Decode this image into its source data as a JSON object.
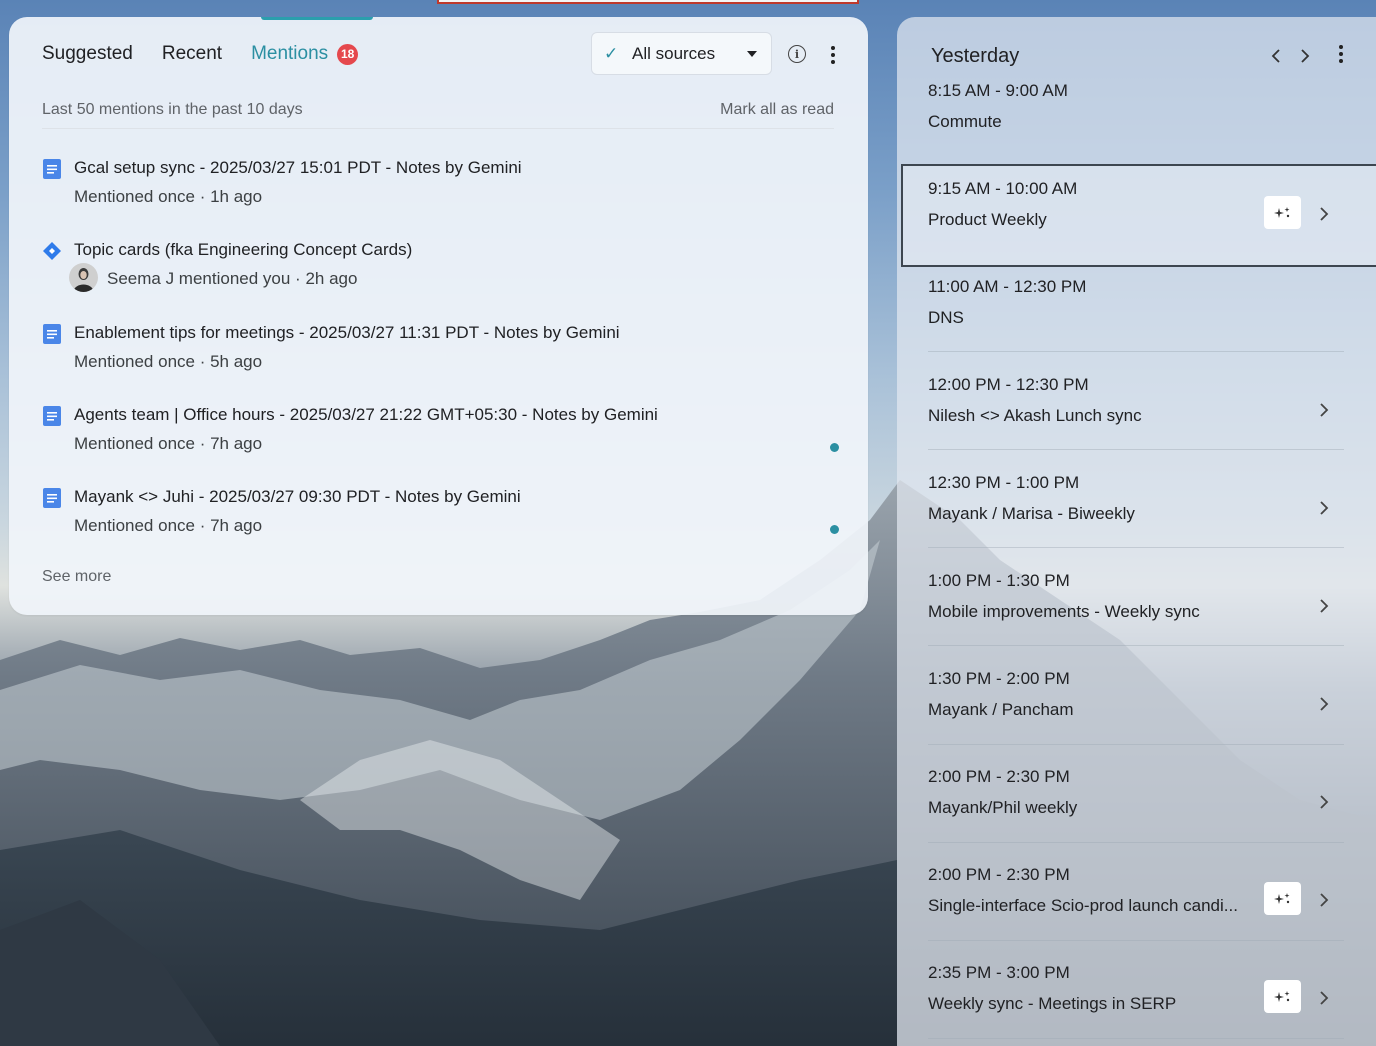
{
  "mentions_panel": {
    "tabs": [
      {
        "label": "Suggested"
      },
      {
        "label": "Recent"
      },
      {
        "label": "Mentions",
        "badge": "18"
      }
    ],
    "source_filter": {
      "selected": "All sources"
    },
    "summary": "Last 50 mentions in the past 10 days",
    "mark_all_read": "Mark all as read",
    "items": [
      {
        "title": "Gcal setup sync - 2025/03/27 15:01 PDT - Notes by Gemini",
        "meta": "Mentioned once · 1h ago",
        "icon": "doc-icon",
        "unread": false
      },
      {
        "title": "Topic cards (fka Engineering Concept Cards)",
        "meta": "Seema J mentioned you · 2h ago",
        "icon": "diamond-icon",
        "unread": false
      },
      {
        "title": "Enablement tips for meetings - 2025/03/27 11:31 PDT - Notes by Gemini",
        "meta": "Mentioned once · 5h ago",
        "icon": "doc-icon",
        "unread": false
      },
      {
        "title": "Agents team | Office hours - 2025/03/27 21:22 GMT+05:30 - Notes by Gemini",
        "meta": "Mentioned once · 7h ago",
        "icon": "doc-icon",
        "unread": true
      },
      {
        "title": "Mayank <> Juhi - 2025/03/27 09:30 PDT - Notes by Gemini",
        "meta": "Mentioned once · 7h ago",
        "icon": "doc-icon",
        "unread": true
      }
    ],
    "see_more": "See more"
  },
  "calendar": {
    "title": "Yesterday",
    "events": [
      {
        "time": "8:15 AM - 9:00 AM",
        "name": "Commute",
        "ai": false,
        "chevron": false
      },
      {
        "time": "9:15 AM - 10:00 AM",
        "name": "Product Weekly",
        "ai": true,
        "chevron": true,
        "highlighted": true
      },
      {
        "time": "11:00 AM - 12:30 PM",
        "name": "DNS",
        "ai": false,
        "chevron": false
      },
      {
        "time": "12:00 PM - 12:30 PM",
        "name": "Nilesh <> Akash Lunch sync",
        "ai": false,
        "chevron": true
      },
      {
        "time": "12:30 PM - 1:00 PM",
        "name": "Mayank / Marisa - Biweekly",
        "ai": false,
        "chevron": true
      },
      {
        "time": "1:00 PM - 1:30 PM",
        "name": "Mobile improvements - Weekly sync",
        "ai": false,
        "chevron": true
      },
      {
        "time": "1:30 PM - 2:00 PM",
        "name": "Mayank / Pancham",
        "ai": false,
        "chevron": true
      },
      {
        "time": "2:00 PM - 2:30 PM",
        "name": "Mayank/Phil weekly",
        "ai": false,
        "chevron": true
      },
      {
        "time": "2:00 PM - 2:30 PM",
        "name": "Single-interface Scio-prod launch candi...",
        "ai": true,
        "chevron": true
      },
      {
        "time": "2:35 PM - 3:00 PM",
        "name": "Weekly sync - Meetings in SERP",
        "ai": true,
        "chevron": true
      }
    ]
  },
  "colors": {
    "accent": "#2b8fa2",
    "badge": "#e5484d",
    "doc_icon": "#4a86e8"
  }
}
